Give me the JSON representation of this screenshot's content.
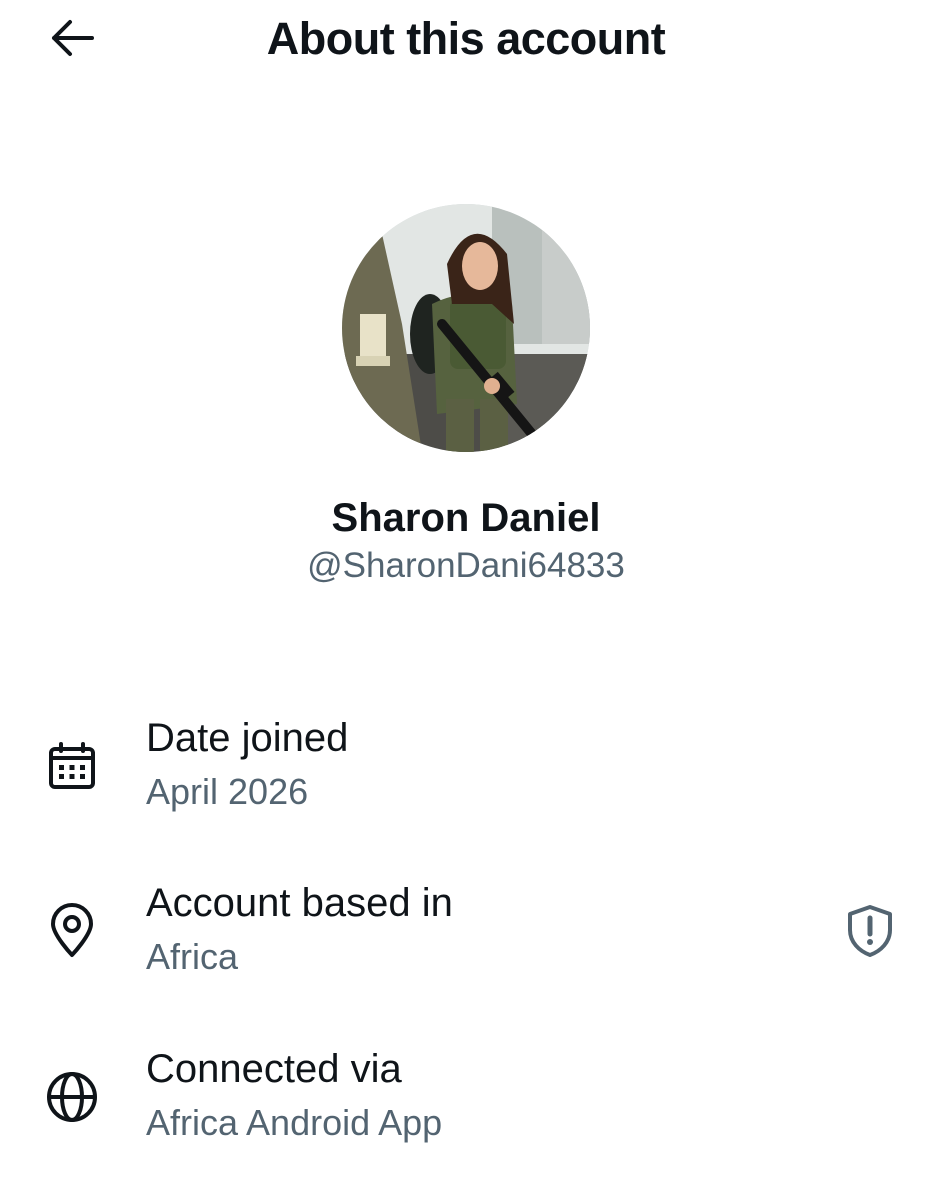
{
  "header": {
    "title": "About this account",
    "back_icon": "arrow-left-icon"
  },
  "profile": {
    "name": "Sharon Daniel",
    "handle": "@SharonDani64833",
    "avatar": "profile-photo"
  },
  "details": [
    {
      "icon": "calendar-icon",
      "label": "Date joined",
      "value": "April 2026"
    },
    {
      "icon": "location-pin-icon",
      "label": "Account based in",
      "value": "Africa",
      "badge_icon": "shield-alert-icon"
    },
    {
      "icon": "globe-icon",
      "label": "Connected via",
      "value": "Africa Android App"
    }
  ],
  "colors": {
    "text_primary": "#0f1419",
    "text_secondary": "#536471",
    "background": "#ffffff"
  }
}
